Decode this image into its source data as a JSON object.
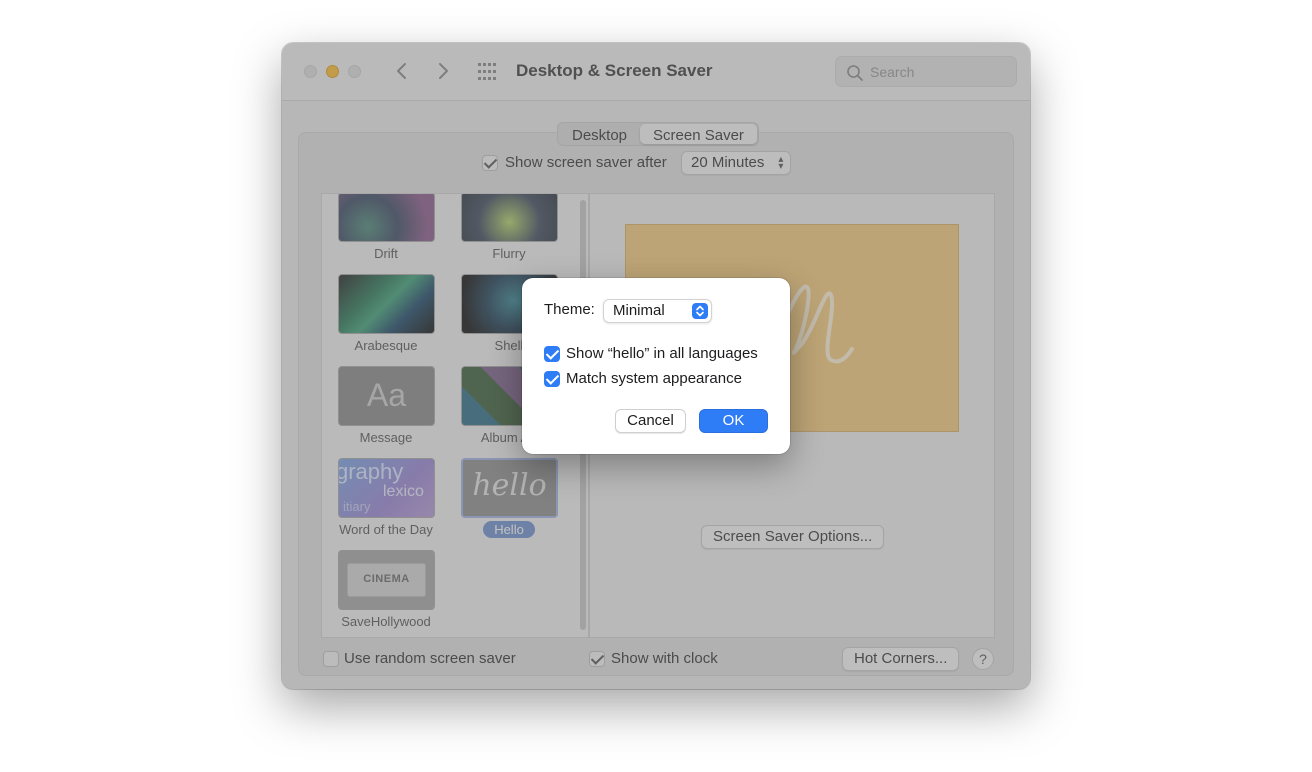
{
  "window": {
    "title": "Desktop & Screen Saver",
    "search_placeholder": "Search"
  },
  "tabs": [
    {
      "label": "Desktop",
      "active": false
    },
    {
      "label": "Screen Saver",
      "active": true
    }
  ],
  "screen_saver": {
    "show_after_label": "Show screen saver after",
    "show_after_checked": true,
    "show_after_value": "20 Minutes",
    "savers": [
      {
        "label": "Drift"
      },
      {
        "label": "Flurry"
      },
      {
        "label": "Arabesque"
      },
      {
        "label": "Shell"
      },
      {
        "label": "Message",
        "thumb_text": "Aa"
      },
      {
        "label": "Album Art"
      },
      {
        "label": "Word of the Day",
        "thumb_text_1": "graphy",
        "thumb_text_2": "lexico",
        "thumb_text_3": "itiary"
      },
      {
        "label": "Hello",
        "thumb_text": "hello",
        "selected": true
      },
      {
        "label": "SaveHollywood",
        "thumb_text": "CINEMA"
      }
    ],
    "options_button": "Screen Saver Options...",
    "random_label": "Use random screen saver",
    "random_checked": false,
    "clock_label": "Show with clock",
    "clock_checked": true,
    "hot_corners_button": "Hot Corners...",
    "help_label": "?"
  },
  "sheet": {
    "theme_label": "Theme:",
    "theme_value": "Minimal",
    "show_hello_label": "Show “hello” in all languages",
    "show_hello_checked": true,
    "match_appearance_label": "Match system appearance",
    "match_appearance_checked": true,
    "cancel_label": "Cancel",
    "ok_label": "OK"
  },
  "colors": {
    "accent": "#2f7df6",
    "preview_background": "#f6cc7c",
    "minimize_button": "#ffbd2e"
  }
}
